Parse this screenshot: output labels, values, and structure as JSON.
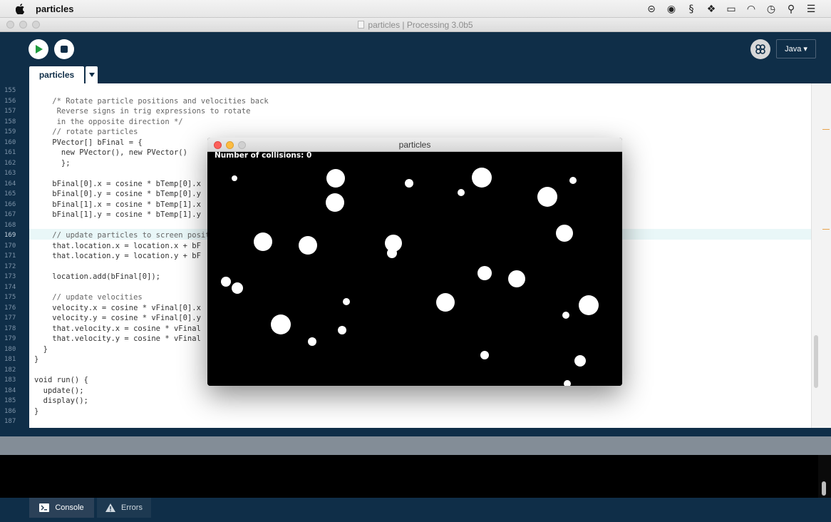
{
  "menubar": {
    "app_name": "particles",
    "tray_icons": [
      "creative-cloud-icon",
      "record-icon",
      "script-icon",
      "dropbox-icon",
      "battery-icon",
      "wifi-icon",
      "time-machine-icon",
      "spotlight-icon",
      "notification-center-icon"
    ]
  },
  "window": {
    "title": "particles | Processing 3.0b5"
  },
  "header": {
    "run_icon": "play-icon",
    "stop_icon": "stop-icon",
    "mode_label": "Java ▾",
    "tab_label": "particles",
    "tab_menu_icon": "triangle-down-icon"
  },
  "editor": {
    "line_numbers": [
      "155",
      "156",
      "157",
      "158",
      "159",
      "160",
      "161",
      "162",
      "163",
      "164",
      "165",
      "166",
      "167",
      "168",
      "169",
      "170",
      "171",
      "172",
      "173",
      "174",
      "175",
      "176",
      "177",
      "178",
      "179",
      "180",
      "181",
      "182",
      "183",
      "184",
      "185",
      "186",
      "187"
    ],
    "active_line": "169",
    "code_lines": [
      "",
      "    /* Rotate particle positions and velocities back",
      "     Reverse signs in trig expressions to rotate",
      "     in the opposite direction */",
      "    // rotate particles",
      "    PVector[] bFinal = {",
      "      new PVector(), new PVector()",
      "      };",
      "",
      "    bFinal[0].x = cosine * bTemp[0].x",
      "    bFinal[0].y = cosine * bTemp[0].y",
      "    bFinal[1].x = cosine * bTemp[1].x",
      "    bFinal[1].y = cosine * bTemp[1].y",
      "",
      "    // update particles to screen position",
      "    that.location.x = location.x + bF",
      "    that.location.y = location.y + bF",
      "",
      "    location.add(bFinal[0]);",
      "",
      "    // update velocities",
      "    velocity.x = cosine * vFinal[0].x",
      "    velocity.y = cosine * vFinal[0].y",
      "    that.velocity.x = cosine * vFinal",
      "    that.velocity.y = cosine * vFinal",
      "  }",
      "}",
      "",
      "void run() {",
      "  update();",
      "  display();",
      "}",
      ""
    ]
  },
  "footer": {
    "console_label": "Console",
    "errors_label": "Errors",
    "console_icon": "terminal-icon",
    "errors_icon": "warning-icon"
  },
  "sketch": {
    "title": "particles",
    "collisions_text": "Number of collisions: 0",
    "particle_color": "#ffffff",
    "background_color": "#000000"
  },
  "colors": {
    "pde_navy": "#0f2e48",
    "comment": "#666666",
    "type": "#d94a1e",
    "keyword": "#2f79a8",
    "close": "#fc605b",
    "minimize": "#fdbc40"
  }
}
